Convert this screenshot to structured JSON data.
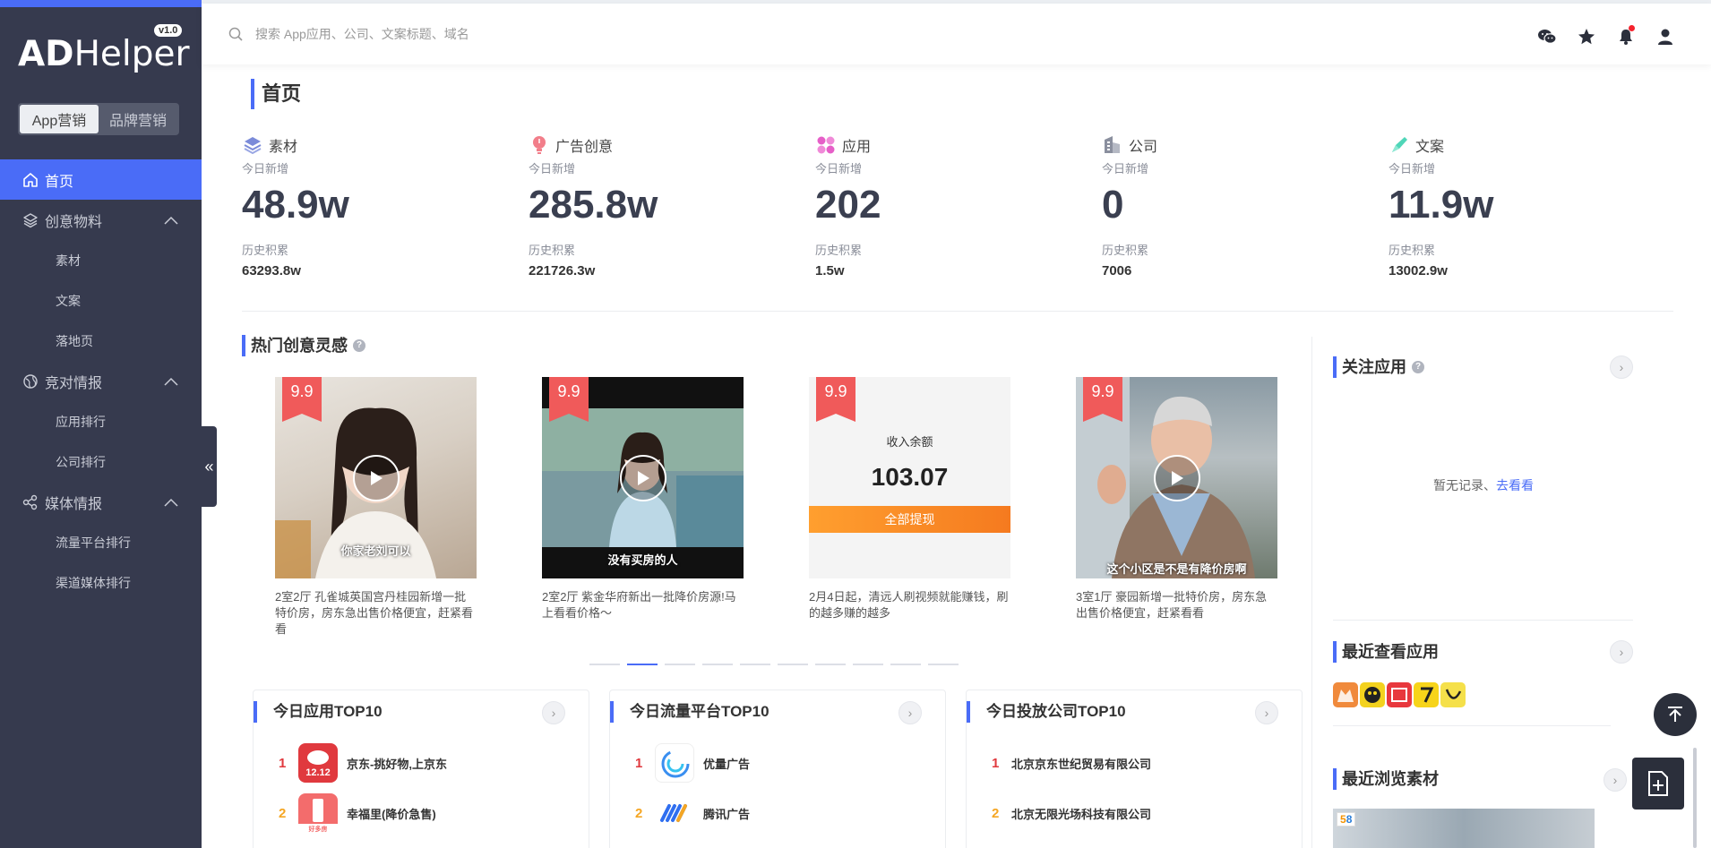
{
  "app": {
    "logo_bold": "AD",
    "logo_rest": "Helper",
    "version": "v1.0"
  },
  "sidebar": {
    "segments": [
      "App营销",
      "品牌营销"
    ],
    "items": [
      {
        "label": "首页",
        "icon": "home-icon",
        "active": true
      },
      {
        "label": "创意物料",
        "icon": "layers-icon"
      },
      {
        "label": "素材"
      },
      {
        "label": "文案"
      },
      {
        "label": "落地页"
      },
      {
        "label": "竞对情报",
        "icon": "globe-icon"
      },
      {
        "label": "应用排行"
      },
      {
        "label": "公司排行"
      },
      {
        "label": "媒体情报",
        "icon": "share-icon"
      },
      {
        "label": "流量平台排行"
      },
      {
        "label": "渠道媒体排行"
      }
    ],
    "collapse_glyph": "«"
  },
  "header": {
    "search_placeholder": "搜索 App应用、公司、文案标题、域名",
    "icons": [
      "wechat-icon",
      "star-icon",
      "bell-icon",
      "user-icon"
    ]
  },
  "page": {
    "title": "首页"
  },
  "stats": [
    {
      "label": "素材",
      "icon": "layers-icon",
      "today_label": "今日新增",
      "today": "48.9w",
      "total_label": "历史积累",
      "total": "63293.8w"
    },
    {
      "label": "广告创意",
      "icon": "bulb-icon",
      "today_label": "今日新增",
      "today": "285.8w",
      "total_label": "历史积累",
      "total": "221726.3w"
    },
    {
      "label": "应用",
      "icon": "apps-icon",
      "today_label": "今日新增",
      "today": "202",
      "total_label": "历史积累",
      "total": "1.5w"
    },
    {
      "label": "公司",
      "icon": "building-icon",
      "today_label": "今日新增",
      "today": "0",
      "total_label": "历史积累",
      "total": "7006"
    },
    {
      "label": "文案",
      "icon": "pen-icon",
      "today_label": "今日新增",
      "today": "11.9w",
      "total_label": "历史积累",
      "total": "13002.9w"
    }
  ],
  "hot": {
    "title": "热门创意灵感",
    "cards": [
      {
        "score": "9.9",
        "caption": "你家老刘可以",
        "desc": "2室2厅 孔雀城英国宫丹桂园新增一批特价房，房东急出售价格便宜，赶紧看看"
      },
      {
        "score": "9.9",
        "caption": "没有买房的人",
        "desc": "2室2厅 紫金华府新出一批降价房源!马上看看价格～"
      },
      {
        "score": "9.9",
        "balance_label": "收入余额",
        "balance": "103.07",
        "button": "全部提现",
        "desc": "2月4日起，清远人刷视频就能赚钱，刷的越多赚的越多"
      },
      {
        "score": "9.9",
        "caption": "这个小区是不是有降价房啊",
        "desc": "3室1厅 豪园新增一批特价房，房东急出售价格便宜，赶紧看看"
      }
    ],
    "dots_total": 10,
    "dots_active": 1
  },
  "right": {
    "follow_title": "关注应用",
    "empty_text": "暂无记录、",
    "empty_link": "去看看",
    "recent_apps_title": "最近查看应用",
    "recent_material_title": "最近浏览素材",
    "recent_material_badge": "58"
  },
  "top10": [
    {
      "title": "今日应用TOP10",
      "rows": [
        {
          "rank": "1",
          "name": "京东-挑好物,上京东",
          "logo_text": "12.12"
        },
        {
          "rank": "2",
          "name": "幸福里(降价急售)",
          "logo_text": "好多房"
        }
      ]
    },
    {
      "title": "今日流量平台TOP10",
      "rows": [
        {
          "rank": "1",
          "name": "优量广告"
        },
        {
          "rank": "2",
          "name": "腾讯广告"
        }
      ]
    },
    {
      "title": "今日投放公司TOP10",
      "rows": [
        {
          "rank": "1",
          "name": "北京京东世纪贸易有限公司"
        },
        {
          "rank": "2",
          "name": "北京无限光场科技有限公司"
        }
      ]
    }
  ],
  "colors": {
    "accent": "#4a6cf7",
    "sidebar": "#363a4e",
    "score": "#f05a5a",
    "rank1": "#e0393e",
    "rank2": "#f5a623"
  }
}
